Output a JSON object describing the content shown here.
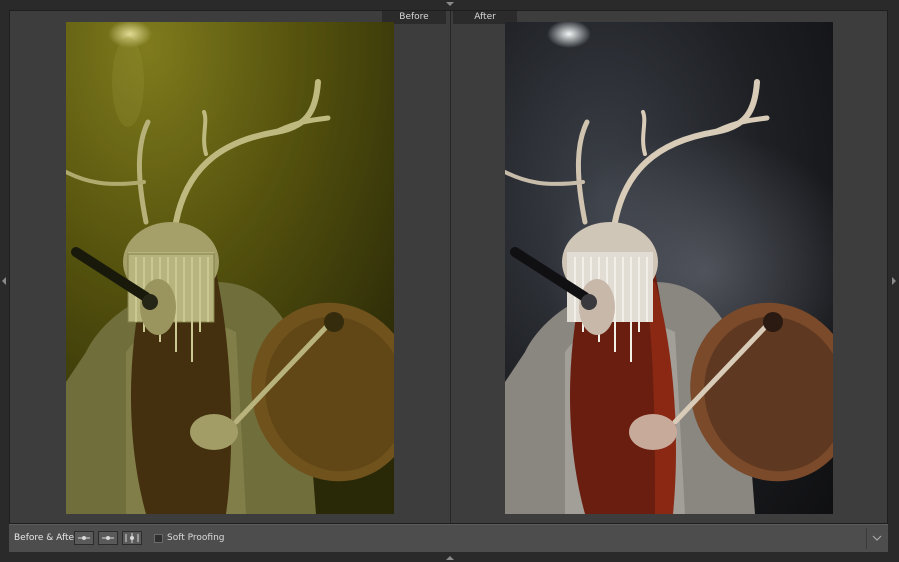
{
  "view": {
    "before_label": "Before",
    "after_label": "After"
  },
  "toolbar": {
    "mode_label": "Before & After :",
    "buttons": [
      "left-right-view-icon",
      "swap-before-after-icon",
      "top-bottom-view-icon"
    ],
    "soft_proofing_label": "Soft Proofing",
    "soft_proofing_checked": false,
    "menu_icon": "chevron-down-icon"
  },
  "panel_arrows": [
    "arrow-up-icon",
    "arrow-down-icon",
    "arrow-left-icon",
    "arrow-right-icon"
  ],
  "colors": {
    "background": "#2a2a2a",
    "canvas": "#3d3d3d",
    "toolbar": "#4d4d4d",
    "before_tint": "#6e6a14",
    "after_tint": "#1a1a1c"
  }
}
